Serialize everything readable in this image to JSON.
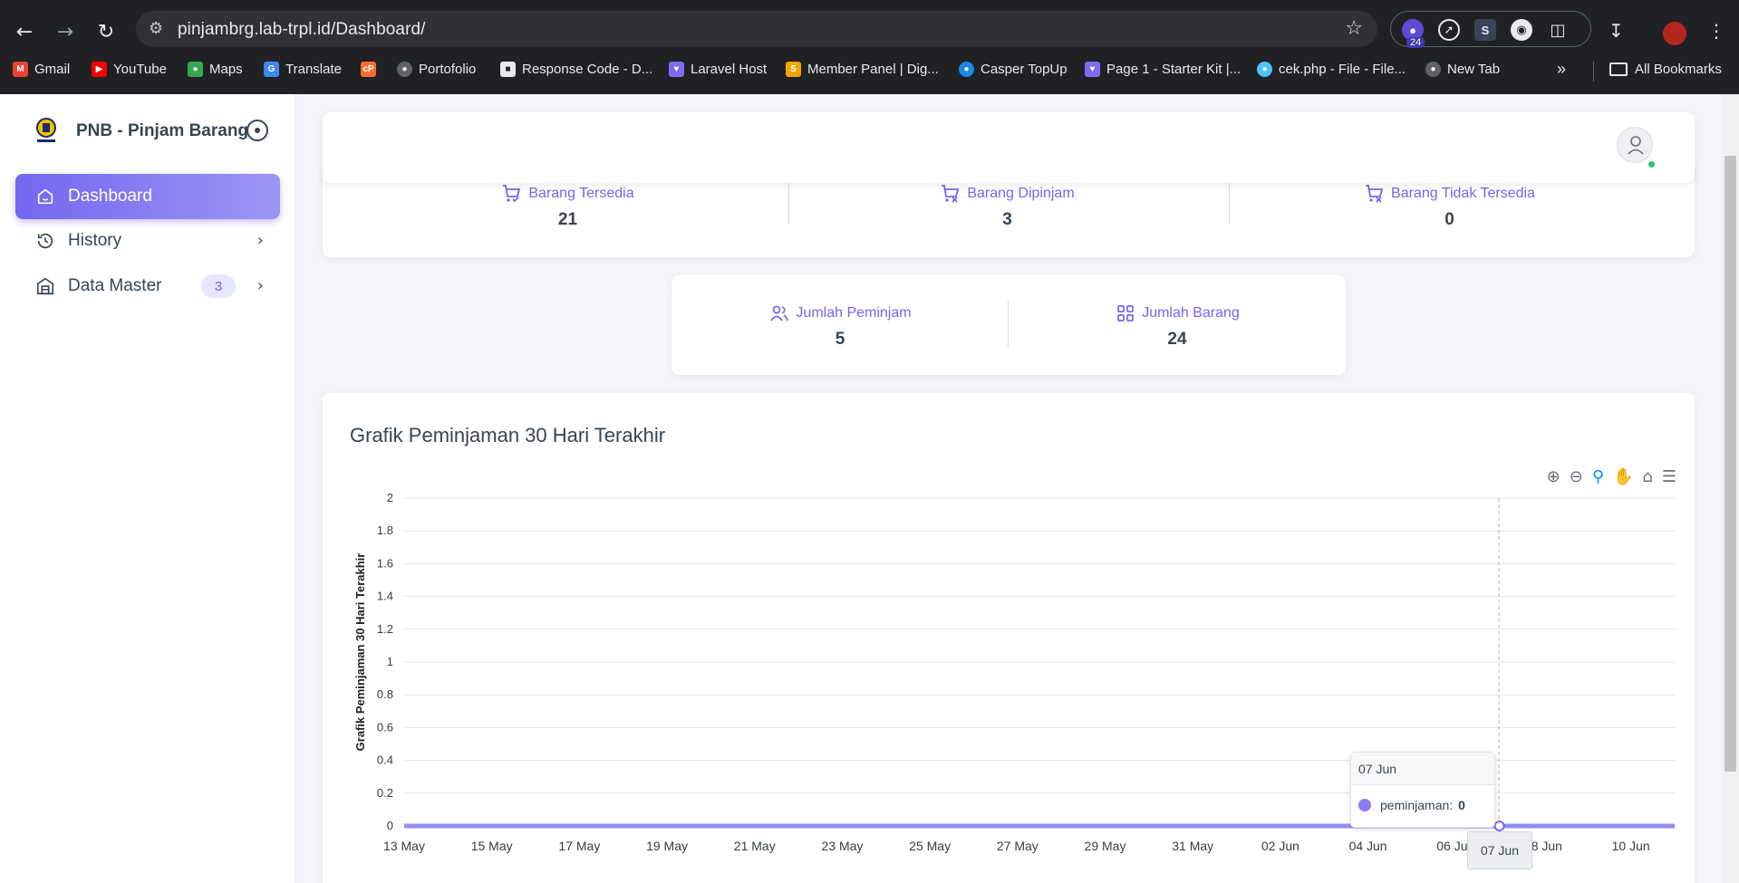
{
  "browser": {
    "url": "pinjambrg.lab-trpl.id/Dashboard/",
    "extension_badge": "24",
    "bookmarks": [
      {
        "label": "Gmail",
        "icon": "gmail-icon",
        "color": "#ea4335"
      },
      {
        "label": "YouTube",
        "icon": "youtube-icon",
        "color": "#ff0000"
      },
      {
        "label": "Maps",
        "icon": "maps-icon",
        "color": "#34a853"
      },
      {
        "label": "Translate",
        "icon": "translate-icon",
        "color": "#4285f4"
      },
      {
        "label": "",
        "icon": "cpanel-icon",
        "color": "#ff6c2c"
      },
      {
        "label": "Portofolio",
        "icon": "globe-icon",
        "color": "#9aa0a6"
      },
      {
        "label": "Response Code - D...",
        "icon": "cube-icon",
        "color": "#e8eaed"
      },
      {
        "label": "Laravel Host",
        "icon": "heart-icon",
        "color": "#7c6cf0"
      },
      {
        "label": "Member Panel | Dig...",
        "icon": "digital-icon",
        "color": "#f0a500"
      },
      {
        "label": "Casper TopUp",
        "icon": "casper-icon",
        "color": "#1e88e5"
      },
      {
        "label": "Page 1 - Starter Kit |...",
        "icon": "heart-icon",
        "color": "#7c6cf0"
      },
      {
        "label": "cek.php - File - File...",
        "icon": "file-icon",
        "color": "#4fc3f7"
      },
      {
        "label": "New Tab",
        "icon": "globe-icon",
        "color": "#9aa0a6"
      }
    ],
    "all_bookmarks": "All Bookmarks"
  },
  "sidebar": {
    "brand": "PNB - Pinjam Barang",
    "items": [
      {
        "label": "Dashboard",
        "icon": "home-icon",
        "active": true
      },
      {
        "label": "History",
        "icon": "history-icon",
        "active": false
      },
      {
        "label": "Data Master",
        "icon": "building-icon",
        "active": false,
        "badge": "3"
      }
    ]
  },
  "stats": {
    "row1": [
      {
        "label": "Barang Tersedia",
        "value": "21",
        "icon": "cart-check-icon"
      },
      {
        "label": "Barang Dipinjam",
        "value": "3",
        "icon": "cart-x-icon"
      },
      {
        "label": "Barang Tidak Tersedia",
        "value": "0",
        "icon": "cart-x-icon"
      }
    ],
    "row2": [
      {
        "label": "Jumlah Peminjam",
        "value": "5",
        "icon": "users-icon"
      },
      {
        "label": "Jumlah Barang",
        "value": "24",
        "icon": "grid-icon"
      }
    ]
  },
  "chart_title": "Grafik Peminjaman 30 Hari Terakhir",
  "chart_data": {
    "type": "area",
    "title": "Grafik Peminjaman 30 Hari Terakhir",
    "ylabel": "Grafik Peminjaman 30 Hari Terakhir",
    "xlabel": "",
    "ylim": [
      0,
      2
    ],
    "y_ticks": [
      "2",
      "1.8",
      "1.6",
      "1.4",
      "1.2",
      "1",
      "0.8",
      "0.6",
      "0.4",
      "0.2",
      "0"
    ],
    "x_ticks": [
      "13 May",
      "15 May",
      "17 May",
      "19 May",
      "21 May",
      "23 May",
      "25 May",
      "27 May",
      "29 May",
      "31 May",
      "02 Jun",
      "04 Jun",
      "06 Jun",
      "08 Jun",
      "10 Jun"
    ],
    "series": [
      {
        "name": "peminjaman",
        "color": "#7367f0",
        "values": [
          0,
          0,
          0,
          0,
          0,
          0,
          0,
          0,
          0,
          0,
          0,
          0,
          0,
          0,
          0,
          0,
          0,
          0,
          0,
          0,
          0,
          0,
          0,
          0,
          0,
          0,
          0,
          0,
          0,
          0
        ]
      }
    ],
    "grid": true,
    "accent": "#7367f0"
  },
  "tooltip": {
    "date": "07 Jun",
    "series_label": "peminjaman:",
    "value": "0",
    "x_label": "07 Jun"
  }
}
